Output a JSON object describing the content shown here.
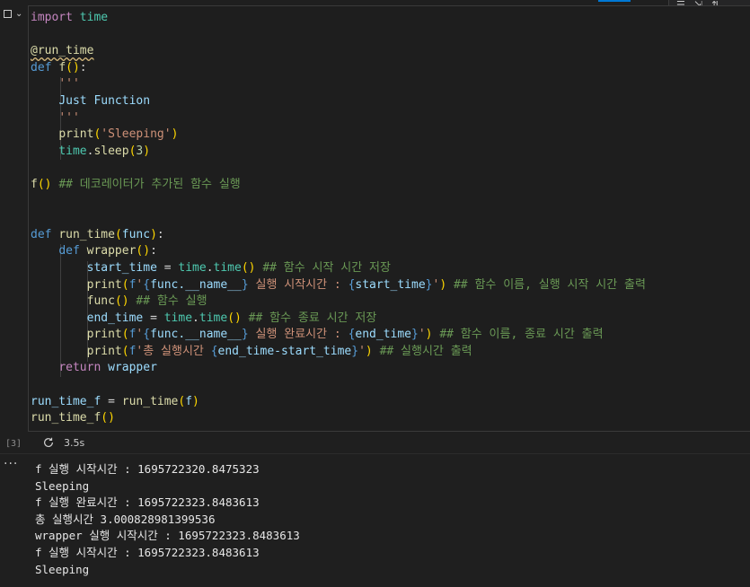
{
  "toolbar": {
    "cell_toggle_icon": "checkbox-icon",
    "chevron_icon": "chevron-down-icon",
    "icons": [
      "list-icon",
      "arrow-out-icon",
      "sort-icon"
    ]
  },
  "code_lines": [
    "import time",
    "",
    "@run_time",
    "def f():",
    "    '''",
    "    Just Function",
    "    '''",
    "    print('Sleeping')",
    "    time.sleep(3)",
    "",
    "f() ## 데코레이터가 추가된 함수 실행",
    "",
    "",
    "def run_time(func):",
    "    def wrapper():",
    "        start_time = time.time() ## 함수 시작 시간 저장",
    "        print(f'{func.__name__} 실행 시작시간 : {start_time}') ## 함수 이름, 실행 시작 시간 출력",
    "        func() ## 함수 실행",
    "        end_time = time.time() ## 함수 종료 시간 저장",
    "        print(f'{func.__name__} 실행 완료시간 : {end_time}') ## 함수 이름, 종료 시간 출력",
    "        print(f'총 실행시간 {end_time-start_time}') ## 실행시간 출력",
    "    return wrapper",
    "",
    "run_time_f = run_time(f)",
    "run_time_f()"
  ],
  "execution": {
    "count": "[3]",
    "duration": "3.5s"
  },
  "output_lines": [
    "f 실행 시작시간 : 1695722320.8475323",
    "Sleeping",
    "f 실행 완료시간 : 1695722323.8483613",
    "총 실행시간 3.000828981399536",
    "wrapper 실행 시작시간 : 1695722323.8483613",
    "f 실행 시작시간 : 1695722323.8483613",
    "Sleeping"
  ],
  "colors": {
    "background": "#1f1f1f",
    "keyword": "#569cd6",
    "function": "#dcdcaa",
    "variable": "#9cdcfe",
    "string": "#ce9178",
    "comment": "#6a9955",
    "accent": "#0078d4"
  }
}
